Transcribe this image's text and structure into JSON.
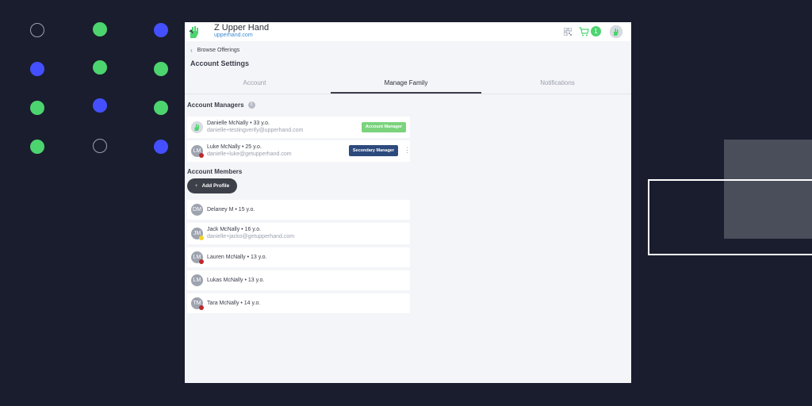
{
  "header": {
    "brand_name": "Z Upper Hand",
    "brand_url": "upperhand.com",
    "cart_count": "1",
    "icons": [
      "logo-icon",
      "qr-code-icon",
      "cart-icon",
      "user-avatar"
    ]
  },
  "breadcrumb": {
    "back_label": "Browse Offerings"
  },
  "page_title": "Account Settings",
  "tabs": [
    {
      "label": "Account",
      "active": false
    },
    {
      "label": "Manage Family",
      "active": true
    },
    {
      "label": "Notifications",
      "active": false
    }
  ],
  "account_managers": {
    "title": "Account Managers",
    "items": [
      {
        "initials": "",
        "name": "Danielle McNally • 33 y.o.",
        "email": "danielle+testingverify@upperhand.com",
        "role": "Account Manager"
      },
      {
        "initials": "LM",
        "name": "Luke McNally • 25 y.o.",
        "email": "danielle+luke@getupperhand.com",
        "role": "Secondary Manager"
      }
    ]
  },
  "account_members": {
    "title": "Account Members",
    "add_label": "Add Profile",
    "items": [
      {
        "initials": "DM",
        "name": "Delaney M • 15 y.o.",
        "email": ""
      },
      {
        "initials": "JM",
        "name": "Jack McNally • 16 y.o.",
        "email": "danielle+jacko@getupperhand.com"
      },
      {
        "initials": "LM",
        "name": "Lauren McNally • 13 y.o.",
        "email": ""
      },
      {
        "initials": "LM",
        "name": "Lukas McNally • 13 y.o.",
        "email": ""
      },
      {
        "initials": "TM",
        "name": "Tara McNally • 14 y.o.",
        "email": ""
      }
    ]
  },
  "colors": {
    "background": "#1a1d2e",
    "accent_green": "#4cd46f",
    "accent_blue": "#4450ff",
    "navy_button": "#2c4a7c",
    "link_blue": "#3a8bd1",
    "status_red": "#c0282b",
    "status_yellow": "#f2d22b"
  }
}
